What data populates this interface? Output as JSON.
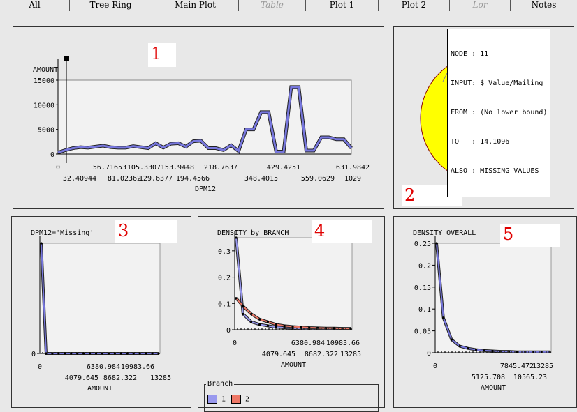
{
  "tabs": [
    "All",
    "Tree Ring",
    "Main Plot",
    "Table",
    "Plot 1",
    "Plot 2",
    "Lor",
    "Notes"
  ],
  "panel_numbers": {
    "p1": "1",
    "p2": "2",
    "p3": "3",
    "p4": "4",
    "p5": "5"
  },
  "tooltip": {
    "lines": [
      "NODE : 11",
      "INPUT: $ Value/Mailing",
      "FROM : (No lower bound)",
      "TO   : 14.1096",
      "ALSO : MISSING VALUES"
    ]
  },
  "panel3": {
    "title": "DPM12='Missing'"
  },
  "panel4": {
    "title": "DENSITY by BRANCH"
  },
  "panel5": {
    "title": "DENSITY OVERALL"
  },
  "legend": {
    "title": "Branch",
    "items": [
      {
        "label": "1",
        "color": "#9999ee"
      },
      {
        "label": "2",
        "color": "#ee7766"
      }
    ]
  },
  "colors": {
    "line": "#7777dd",
    "pie_yellow": "#ffff00",
    "pie_orange": "#ffa500",
    "pie_border": "#8b0000"
  },
  "chart_data": [
    {
      "type": "line",
      "title": "",
      "ylabel": "AMOUNT",
      "xlabel": "DPM12",
      "ylim": [
        0,
        15000
      ],
      "yticks": [
        "0",
        "5000",
        "10000",
        "15000"
      ],
      "xticks_upper": [
        "0",
        "56.71653",
        "105.3307",
        "153.9448",
        "218.7637",
        "429.4251",
        "631.9842"
      ],
      "xticks_lower": [
        "32.40944",
        "81.02362",
        "129.6377",
        "194.4566",
        "348.4015",
        "559.0629",
        "1029"
      ],
      "values": [
        300,
        800,
        1200,
        1400,
        1300,
        1500,
        1700,
        1400,
        1300,
        1300,
        1600,
        1400,
        1200,
        2200,
        1300,
        2100,
        2200,
        1500,
        2600,
        2700,
        1200,
        1200,
        800,
        1800,
        600,
        5000,
        5000,
        8500,
        8500,
        500,
        500,
        13600,
        13600,
        700,
        700,
        3400,
        3400,
        3000,
        3000,
        1200
      ]
    },
    {
      "type": "pie",
      "slices": [
        {
          "label": "outer-yellow",
          "value": 0.8
        },
        {
          "label": "outer-orange",
          "value": 0.2
        }
      ]
    },
    {
      "type": "line",
      "title": "DPM12='Missing'",
      "xlabel": "AMOUNT",
      "yticks": [
        "0"
      ],
      "xticks_upper": [
        "0",
        "6380.984",
        "10983.66"
      ],
      "xticks_lower": [
        "4079.645",
        "8682.322",
        "13285"
      ],
      "values": [
        1.0,
        0,
        0,
        0,
        0,
        0,
        0,
        0,
        0,
        0,
        0,
        0,
        0,
        0,
        0,
        0,
        0,
        0,
        0,
        0
      ]
    },
    {
      "type": "line",
      "title": "DENSITY by BRANCH",
      "xlabel": "AMOUNT",
      "ylim": [
        0,
        0.35
      ],
      "yticks": [
        "0",
        "0.1",
        "0.2",
        "0.3"
      ],
      "xticks_upper": [
        "0",
        "6380.984",
        "10983.66"
      ],
      "xticks_lower": [
        "4079.645",
        "8682.322",
        "13285"
      ],
      "series": [
        {
          "name": "1",
          "values": [
            0.35,
            0.06,
            0.03,
            0.02,
            0.015,
            0.01,
            0.008,
            0.006,
            0.005,
            0.004,
            0.004,
            0.003,
            0.003,
            0.003,
            0.003
          ]
        },
        {
          "name": "2",
          "values": [
            0.12,
            0.09,
            0.06,
            0.04,
            0.03,
            0.02,
            0.015,
            0.012,
            0.01,
            0.008,
            0.007,
            0.006,
            0.006,
            0.005,
            0.005
          ]
        }
      ]
    },
    {
      "type": "line",
      "title": "DENSITY OVERALL",
      "xlabel": "AMOUNT",
      "ylim": [
        0,
        0.25
      ],
      "yticks": [
        "0",
        "0.05",
        "0.1",
        "0.15",
        "0.2",
        "0.25"
      ],
      "xticks_upper": [
        "0",
        "7845.472",
        "13285"
      ],
      "xticks_lower": [
        "5125.708",
        "10565.23"
      ],
      "values": [
        0.25,
        0.08,
        0.03,
        0.015,
        0.01,
        0.007,
        0.005,
        0.004,
        0.003,
        0.003,
        0.002,
        0.002,
        0.002,
        0.002,
        0.002
      ]
    }
  ]
}
